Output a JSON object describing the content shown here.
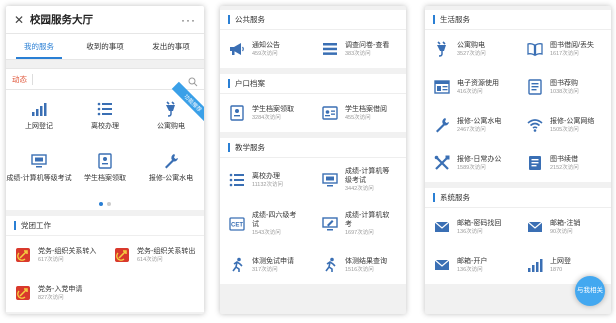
{
  "app": {
    "title": "校园服务大厅",
    "close_icon": "close-icon",
    "more_label": "···"
  },
  "tabs": [
    {
      "label": "我的服务",
      "active": true
    },
    {
      "label": "收到的事项",
      "active": false
    },
    {
      "label": "发出的事项",
      "active": false
    }
  ],
  "search": {
    "label": "动态",
    "placeholder": "",
    "icon": "search-icon"
  },
  "quick_grid": {
    "ribbon": "功能推荐",
    "items": [
      {
        "label": "上网登记",
        "icon": "bar-signal-icon"
      },
      {
        "label": "离校办理",
        "icon": "list-icon"
      },
      {
        "label": "公寓购电",
        "icon": "plug-icon"
      },
      {
        "label": "成绩-计算机等级考试",
        "icon": "monitor-icon"
      },
      {
        "label": "学生档案领取",
        "icon": "id-card-icon"
      },
      {
        "label": "报修-公寓水电",
        "icon": "wrench-icon"
      }
    ],
    "page_dots": 2,
    "active_dot": 0
  },
  "party": {
    "title": "党团工作",
    "items": [
      {
        "name": "党务-组织关系转入",
        "count": "617次访问",
        "icon": "party-icon"
      },
      {
        "name": "党务-组织关系转出",
        "count": "614次访问",
        "icon": "party-icon"
      },
      {
        "name": "党务-入党申请",
        "count": "827次访问",
        "icon": "party-icon"
      }
    ]
  },
  "public": {
    "title": "公共服务",
    "items": [
      {
        "name": "通知公告",
        "count": "459次访问",
        "icon": "megaphone-icon"
      },
      {
        "name": "调查问卷-查看",
        "count": "383次访问",
        "icon": "list-icon"
      }
    ]
  },
  "household": {
    "title": "户口档案",
    "items": [
      {
        "name": "学生档案领取",
        "count": "3284次访问",
        "icon": "id-card-icon"
      },
      {
        "name": "学生档案借阅",
        "count": "455次访问",
        "icon": "profile-card-icon"
      }
    ]
  },
  "teaching": {
    "title": "教学服务",
    "items": [
      {
        "name": "离校办理",
        "count": "11132次访问",
        "icon": "list-icon"
      },
      {
        "name": "成绩-计算机等级考试",
        "count": "3442次访问",
        "icon": "monitor-icon"
      },
      {
        "name": "成绩-四六级考试",
        "count": "1543次访问",
        "icon": "cet-icon"
      },
      {
        "name": "成绩-计算机软考",
        "count": "1697次访问",
        "icon": "monitor-pen-icon"
      },
      {
        "name": "体测免试申请",
        "count": "317次访问",
        "icon": "runner-icon"
      },
      {
        "name": "体测结果查询",
        "count": "1516次访问",
        "icon": "runner-icon"
      }
    ]
  },
  "life": {
    "title": "生活服务",
    "items": [
      {
        "name": "公寓购电",
        "count": "3527次访问",
        "icon": "plug-icon"
      },
      {
        "name": "图书借阅/丢失",
        "count": "1617次访问",
        "icon": "book-icon"
      },
      {
        "name": "电子资源使用",
        "count": "416次访问",
        "icon": "window-icon"
      },
      {
        "name": "图书荐购",
        "count": "1038次访问",
        "icon": "book-icon"
      },
      {
        "name": "报修-公寓水电",
        "count": "2467次访问",
        "icon": "wrench-icon"
      },
      {
        "name": "报修-公寓网络",
        "count": "1505次访问",
        "icon": "wifi-icon"
      },
      {
        "name": "报修-日常办公",
        "count": "1589次访问",
        "icon": "tools-icon"
      },
      {
        "name": "图书续借",
        "count": "2152次访问",
        "icon": "book-icon"
      }
    ]
  },
  "system": {
    "title": "系统服务",
    "items": [
      {
        "name": "邮箱-密码找回",
        "count": "136次访问",
        "icon": "mail-icon"
      },
      {
        "name": "邮箱-注销",
        "count": "90次访问",
        "icon": "mail-icon"
      },
      {
        "name": "邮箱-开户",
        "count": "136次访问",
        "icon": "mail-icon"
      },
      {
        "name": "上网登",
        "count": "1870",
        "icon": "bar-signal-icon"
      }
    ]
  },
  "float_button": {
    "label": "与我相关"
  },
  "colors": {
    "accent": "#2a7fd4",
    "icon": "#3a6fb4",
    "badge_red": "#d9392c",
    "float": "#43a8f0"
  }
}
